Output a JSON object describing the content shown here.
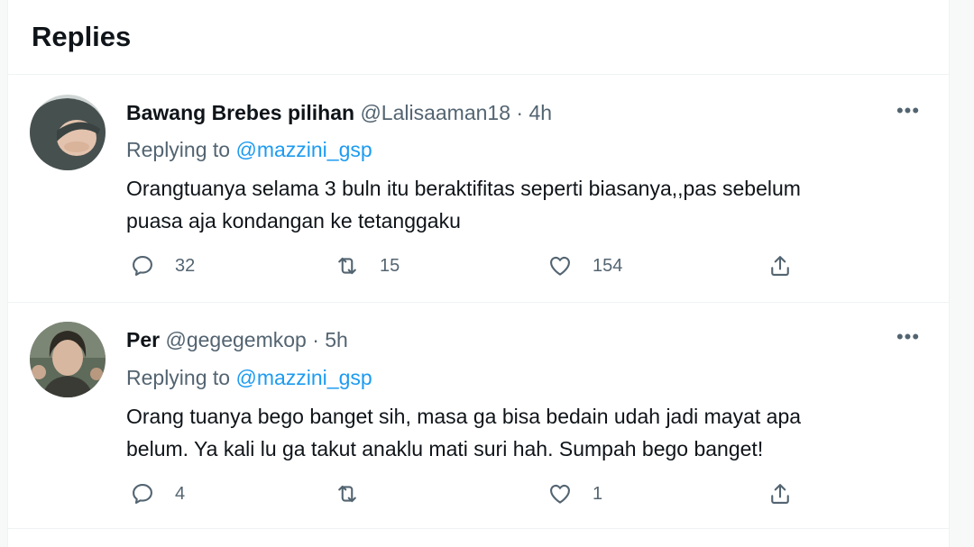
{
  "header": {
    "title": "Replies"
  },
  "tweets": [
    {
      "name": "Bawang Brebes pilihan",
      "handle": "@Lalisaaman18",
      "time": "· 4h",
      "reply_prefix": "Replying to",
      "reply_to": "@mazzini_gsp",
      "lines": [
        "Orangtuanya selama 3 buln itu beraktifitas seperti biasanya,,pas sebelum",
        "puasa aja kondangan ke tetanggaku"
      ],
      "replies": "32",
      "retweets": "15",
      "likes": "154"
    },
    {
      "name": "Per",
      "handle": "@gegegemkop",
      "time": "· 5h",
      "reply_prefix": "Replying to",
      "reply_to": "@mazzini_gsp",
      "lines": [
        "Orang tuanya bego banget sih, masa ga bisa bedain udah jadi mayat apa",
        "belum. Ya kali lu ga takut anaklu mati suri hah. Sumpah bego banget!"
      ],
      "replies": "4",
      "retweets": "",
      "likes": "1"
    }
  ],
  "icons": {
    "reply": "reply-icon",
    "retweet": "retweet-icon",
    "like": "heart-icon",
    "share": "share-icon",
    "more": "more-icon"
  },
  "colors": {
    "link": "#1d9bf0",
    "secondary_text": "#536471",
    "primary_text": "#0f1419"
  }
}
